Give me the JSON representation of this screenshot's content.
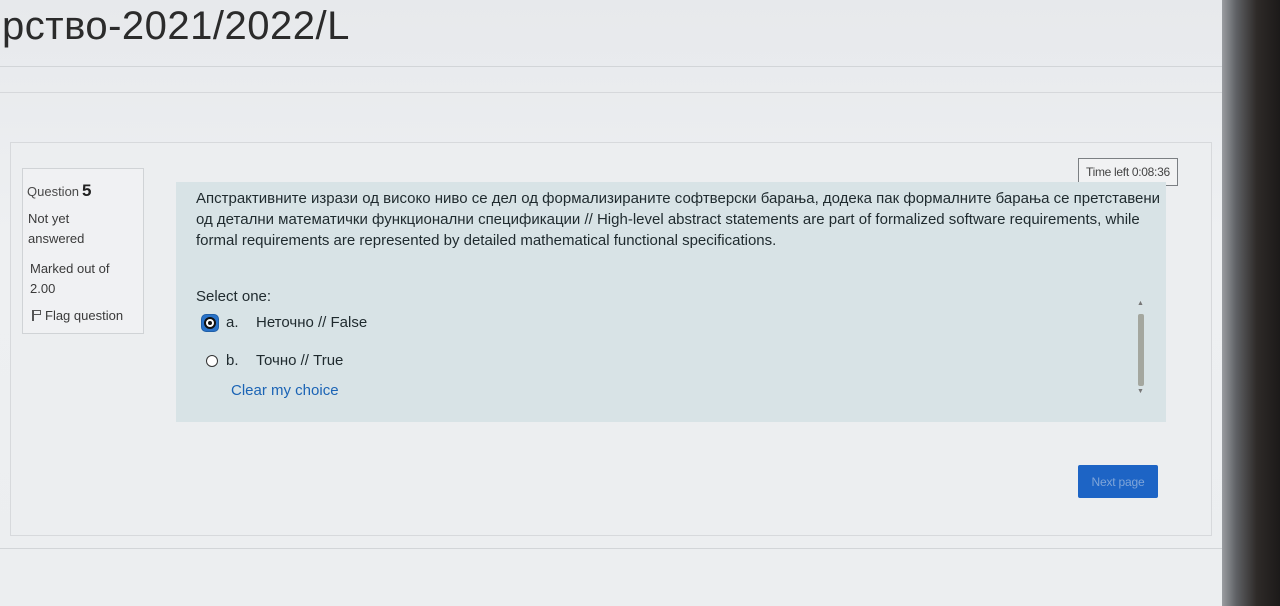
{
  "page": {
    "title": "рство-2021/2022/L"
  },
  "question_info": {
    "question_label": "Question",
    "question_number": "5",
    "state": "Not yet answered",
    "mark_label": "Marked out of",
    "mark_value": "2.00",
    "flag_label": "Flag question"
  },
  "timer": {
    "text": "Time left 0:08:36"
  },
  "question": {
    "text": "Апстрактивните изрази од високо ниво се дел од формализираните софтверски барања, додека пак формалните барања се претставени од детални математички функционални спецификации // High-level abstract statements are part of formalized software requirements, while formal requirements are represented by detailed mathematical functional specifications.",
    "prompt": "Select one:",
    "options": [
      {
        "letter": "a.",
        "label": "Неточно // False",
        "selected": true
      },
      {
        "letter": "b.",
        "label": "Точно // True",
        "selected": false
      }
    ],
    "clear_label": "Clear my choice"
  },
  "navigation": {
    "next_label": "Next page"
  },
  "colors": {
    "question_bg": "#d8e3e6",
    "link": "#1b64b5",
    "primary_button": "#1d64c5",
    "focus_ring": "#2a73c9"
  }
}
